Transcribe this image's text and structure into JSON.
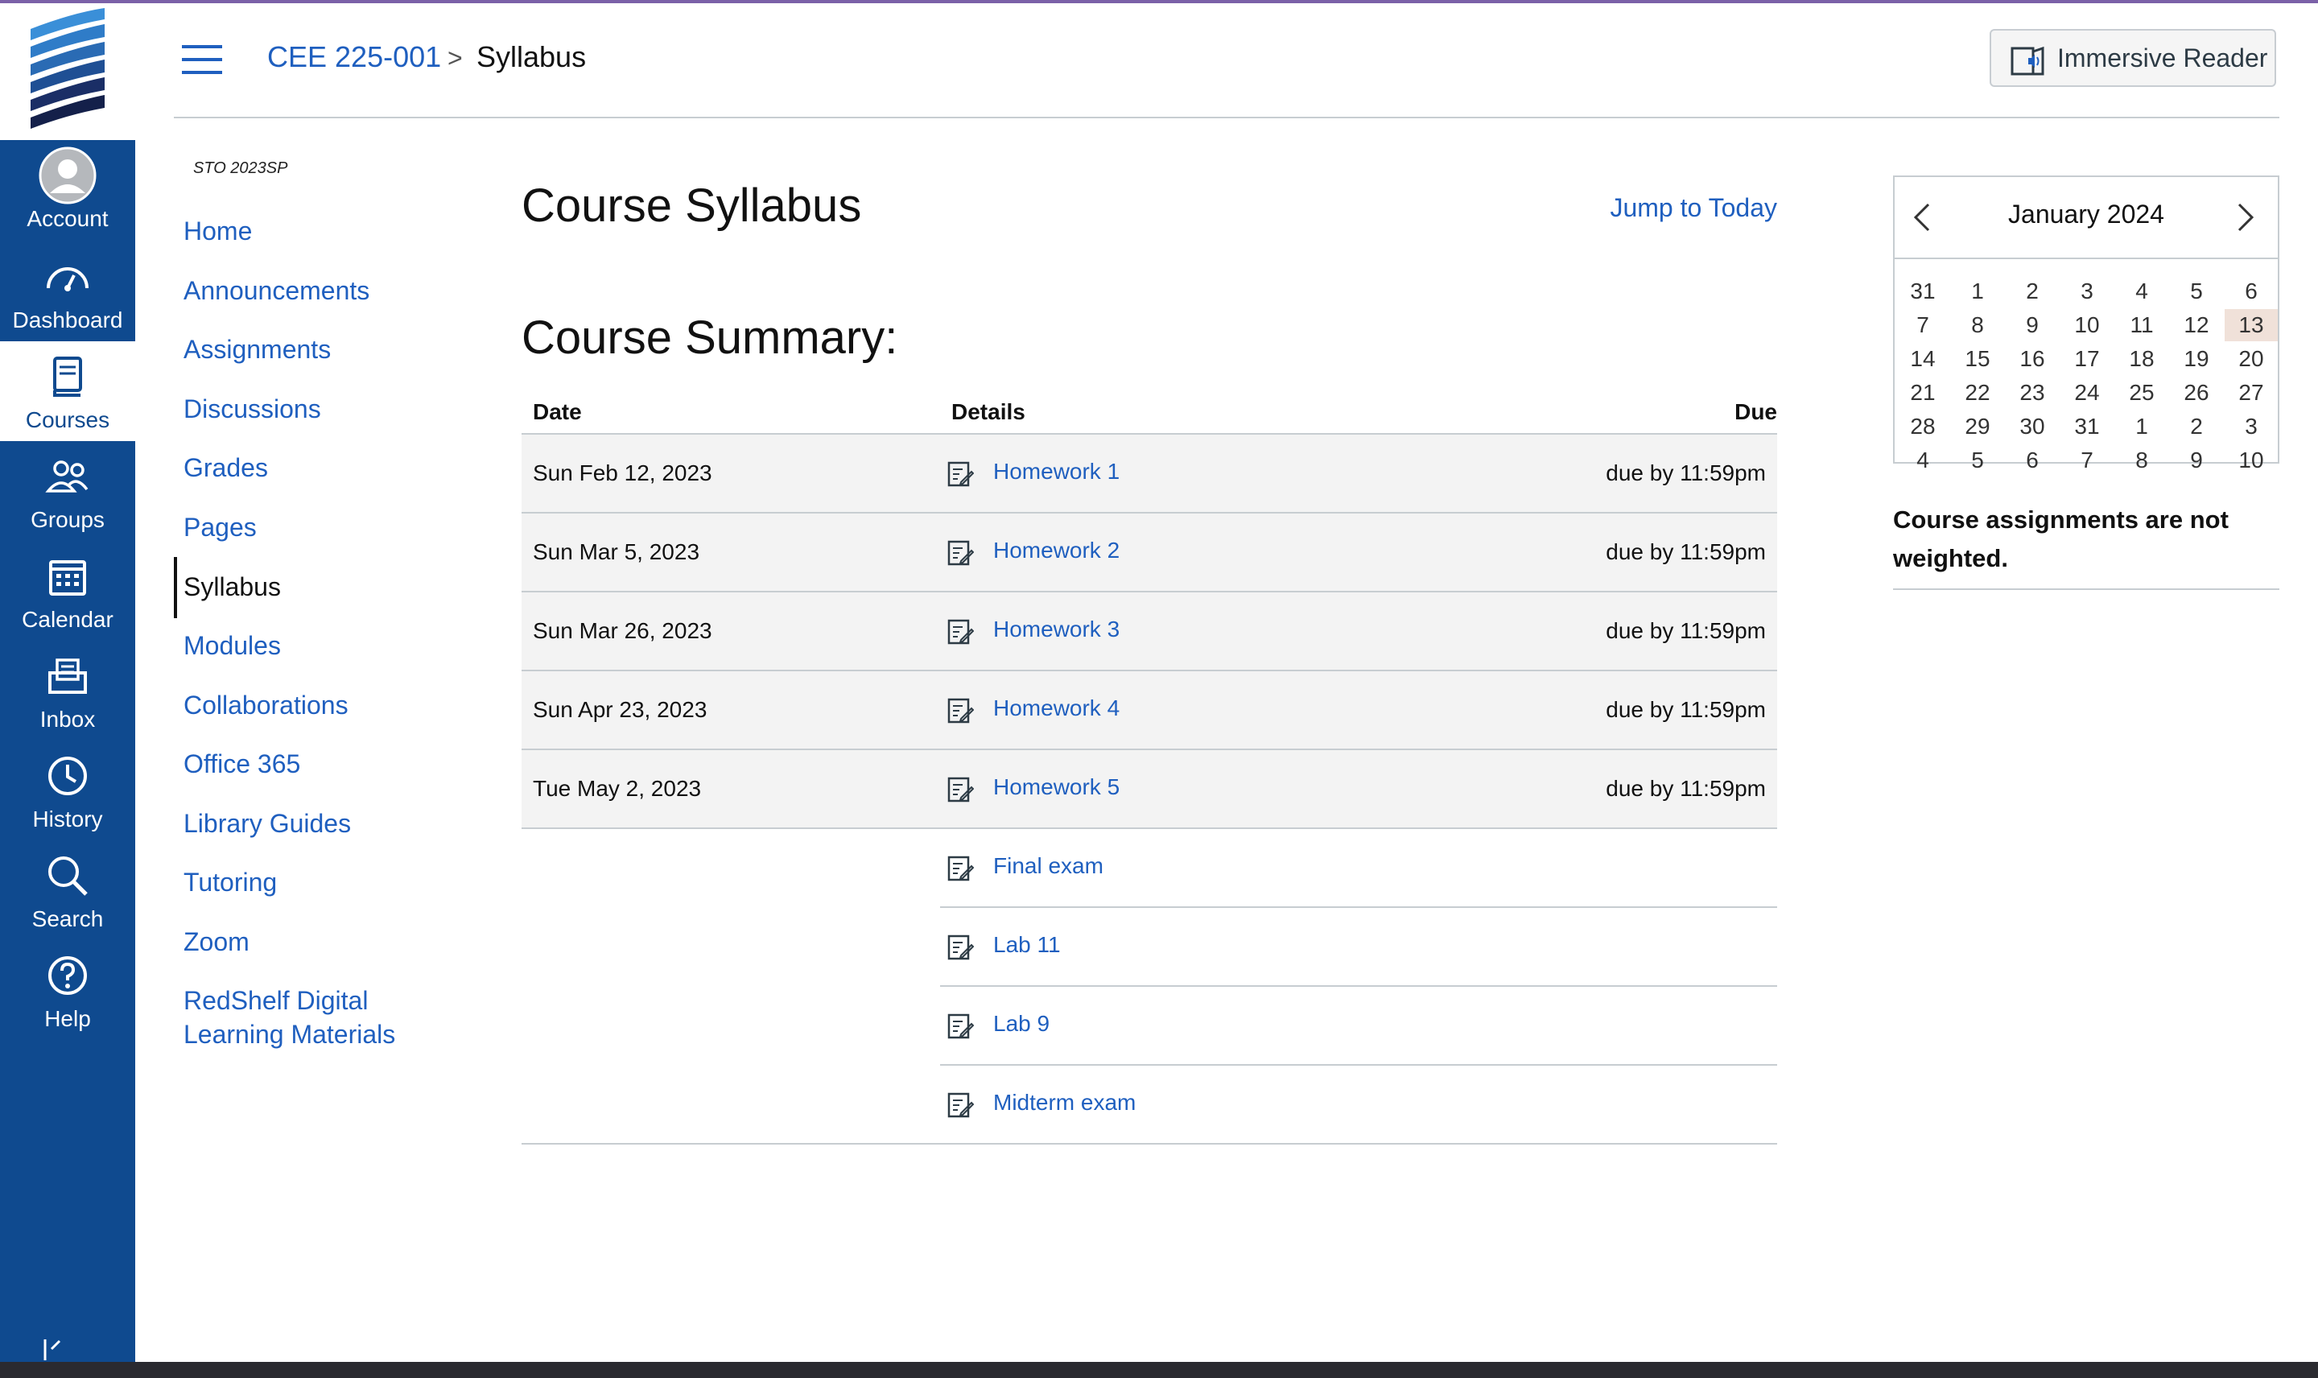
{
  "colors": {
    "nav_bg": "#0f4a8f",
    "link": "#1f5fbf",
    "today_bg": "#f0e1d9",
    "row_shade": "#f3f3f3"
  },
  "global_nav": {
    "items": [
      {
        "label": "Account",
        "icon": "account-avatar-icon"
      },
      {
        "label": "Dashboard",
        "icon": "dashboard-gauge-icon"
      },
      {
        "label": "Courses",
        "icon": "courses-book-icon",
        "active": true
      },
      {
        "label": "Groups",
        "icon": "groups-people-icon"
      },
      {
        "label": "Calendar",
        "icon": "calendar-icon"
      },
      {
        "label": "Inbox",
        "icon": "inbox-icon"
      },
      {
        "label": "History",
        "icon": "history-clock-icon"
      },
      {
        "label": "Search",
        "icon": "search-icon"
      },
      {
        "label": "Help",
        "icon": "help-icon"
      }
    ]
  },
  "header": {
    "course": "CEE 225-001",
    "separator": ">",
    "current": "Syllabus",
    "immersive_reader": "Immersive Reader"
  },
  "course_nav": {
    "term": "STO 2023SP",
    "links": [
      "Home",
      "Announcements",
      "Assignments",
      "Discussions",
      "Grades",
      "Pages",
      "Syllabus",
      "Modules",
      "Collaborations",
      "Office 365",
      "Library Guides",
      "Tutoring",
      "Zoom",
      "RedShelf Digital Learning Materials"
    ],
    "active": "Syllabus"
  },
  "main": {
    "title": "Course Syllabus",
    "jump_to_today": "Jump to Today",
    "summary_title": "Course Summary:",
    "columns": {
      "date": "Date",
      "details": "Details",
      "due": "Due"
    },
    "rows": [
      {
        "date": "Sun Feb 12, 2023",
        "details": "Homework 1",
        "due": "due by 11:59pm"
      },
      {
        "date": "Sun Mar 5, 2023",
        "details": "Homework 2",
        "due": "due by 11:59pm"
      },
      {
        "date": "Sun Mar 26, 2023",
        "details": "Homework 3",
        "due": "due by 11:59pm"
      },
      {
        "date": "Sun Apr 23, 2023",
        "details": "Homework 4",
        "due": "due by 11:59pm"
      },
      {
        "date": "Tue May 2, 2023",
        "details": "Homework 5",
        "due": "due by 11:59pm"
      },
      {
        "date": "",
        "details": "Final exam",
        "due": ""
      },
      {
        "date": "",
        "details": "Lab 11",
        "due": ""
      },
      {
        "date": "",
        "details": "Lab 9",
        "due": ""
      },
      {
        "date": "",
        "details": "Midterm exam",
        "due": ""
      }
    ]
  },
  "calendar": {
    "month_label": "January 2024",
    "today": "13",
    "weeks": [
      [
        "31",
        "1",
        "2",
        "3",
        "4",
        "5",
        "6"
      ],
      [
        "7",
        "8",
        "9",
        "10",
        "11",
        "12",
        "13"
      ],
      [
        "14",
        "15",
        "16",
        "17",
        "18",
        "19",
        "20"
      ],
      [
        "21",
        "22",
        "23",
        "24",
        "25",
        "26",
        "27"
      ],
      [
        "28",
        "29",
        "30",
        "31",
        "1",
        "2",
        "3"
      ],
      [
        "4",
        "5",
        "6",
        "7",
        "8",
        "9",
        "10"
      ]
    ]
  },
  "sidebar_note": "Course assignments are not weighted."
}
